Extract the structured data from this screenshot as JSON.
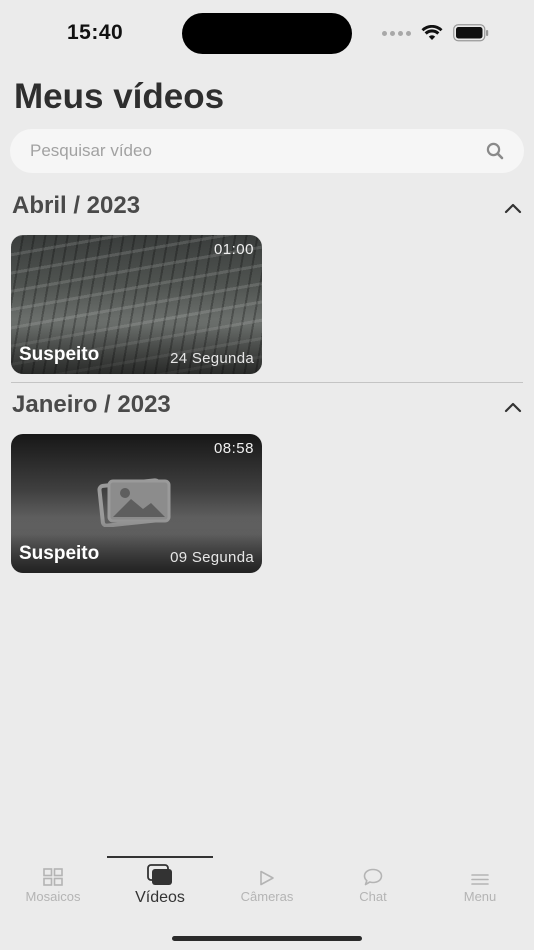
{
  "status_bar": {
    "time": "15:40"
  },
  "header": {
    "title": "Meus vídeos"
  },
  "search": {
    "placeholder": "Pesquisar vídeo",
    "value": ""
  },
  "sections": [
    {
      "title": "Abril / 2023",
      "videos": [
        {
          "title": "Suspeito",
          "duration": "01:00",
          "date": "24 Segunda",
          "thumbnail": "classroom-camera-frame"
        }
      ]
    },
    {
      "title": "Janeiro / 2023",
      "videos": [
        {
          "title": "Suspeito",
          "duration": "08:58",
          "date": "09 Segunda",
          "thumbnail": "photo-placeholder-icon"
        }
      ]
    }
  ],
  "tab_bar": {
    "active": "Vídeos",
    "tabs": [
      {
        "label": "Mosaicos",
        "icon": "grid-icon"
      },
      {
        "label": "Vídeos",
        "icon": "videos-stack-icon"
      },
      {
        "label": "Câmeras",
        "icon": "play-icon"
      },
      {
        "label": "Chat",
        "icon": "chat-bubble-icon"
      },
      {
        "label": "Menu",
        "icon": "menu-icon"
      }
    ]
  },
  "colors": {
    "background": "#ebebeb",
    "search_background": "#f6f6f6",
    "active_tab": "#333333",
    "inactive_tab": "#b4b4b4"
  }
}
